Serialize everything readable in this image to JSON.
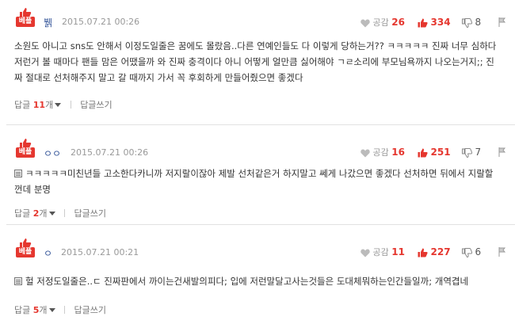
{
  "badge_label": "베플",
  "gong_label": "공감",
  "reply_write_label": "답글쓰기",
  "colors": {
    "accent": "#e5372f",
    "author": "#3a5a9c"
  },
  "comments": [
    {
      "author": "뷁",
      "date": "2015.07.21 00:26",
      "gong": "26",
      "likes": "334",
      "dislikes": "8",
      "text": "소원도 아니고 sns도 안해서 이정도일줄은 꿈에도 몰랐음..다른 연예인들도 다 이렇게 당하는거?? ㅋㅋㅋㅋㅋ 진짜 너무 심하다 저런거 볼 때마다 팬들 맘은 어땠을까 와 진짜 충격이다 아니 어떻게 얼만큼 싫어해야 ㄱㄹ소리에 부모님욕까지 나오는거지;; 진짜 절대로 선처해주지 말고 갈 때까지 가서 꼭 후회하게 만들어줬으면 좋겠다",
      "reply_prefix": "답글 ",
      "reply_count": "11",
      "reply_suffix": "개"
    },
    {
      "author": "ㅇㅇ",
      "date": "2015.07.21 00:26",
      "gong": "16",
      "likes": "251",
      "dislikes": "7",
      "text": "ㅋㅋㅋㅋㅋ미친년들 고소한다카니까 저지랄이잖아 제발 선처같은거 하지말고 쎄게 나갔으면 좋겠다 선처하면 뒤에서 지랄할껀데 분명",
      "reply_prefix": "답글 ",
      "reply_count": "2",
      "reply_suffix": "개"
    },
    {
      "author": "ㅇ",
      "date": "2015.07.21 00:21",
      "gong": "11",
      "likes": "227",
      "dislikes": "6",
      "text": "헐 저정도일줄은..ㄷ 진짜판에서 까이는건새발의피다; 입에 저런말달고사는것들은 도대체뭐하는인간들일까; 개역겹네",
      "reply_prefix": "답글 ",
      "reply_count": "5",
      "reply_suffix": "개"
    }
  ]
}
